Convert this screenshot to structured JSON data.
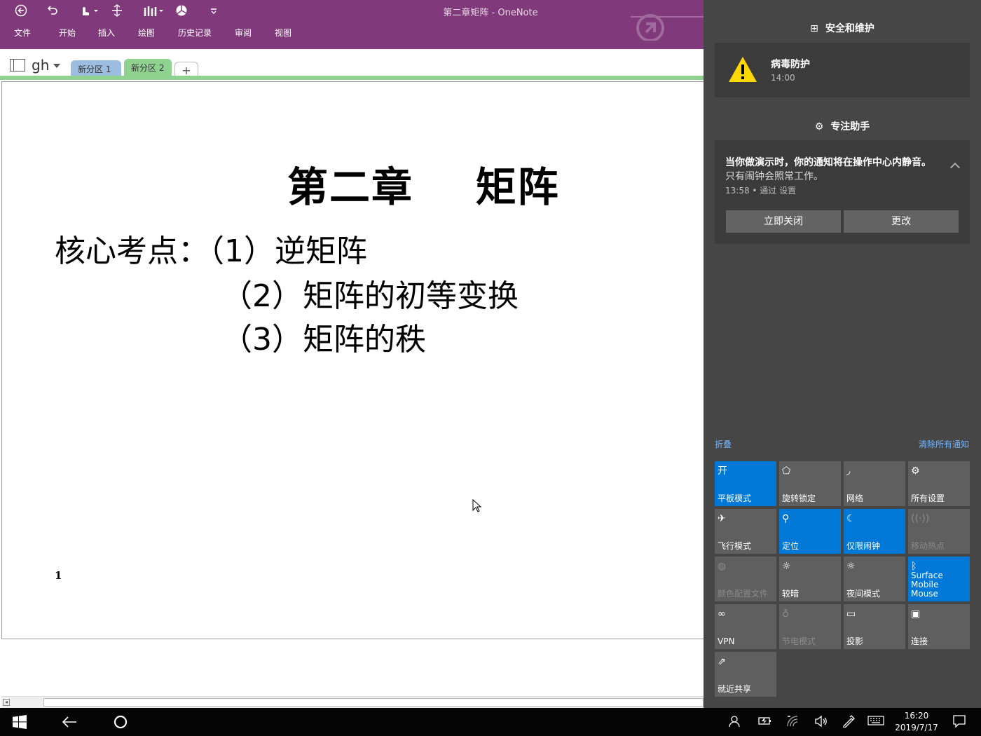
{
  "window": {
    "title": "第二章矩阵 - OneNote",
    "quick_access": [
      "back-icon",
      "undo-icon",
      "touch-mode-icon",
      "insert-space-icon",
      "pens-icon",
      "pie-icon",
      "customize-icon"
    ],
    "menu": [
      "文件",
      "开始",
      "插入",
      "绘图",
      "历史记录",
      "审阅",
      "视图"
    ]
  },
  "notebook": {
    "name": "gh",
    "sections": [
      "新分区 1",
      "新分区 2"
    ],
    "add_section": "+"
  },
  "page": {
    "title": "第二章    矩阵",
    "key_points_label": "核心考点：",
    "key_points": [
      "（1）逆矩阵",
      "（2）矩阵的初等变换",
      "（3）矩阵的秩"
    ],
    "page_number": "1"
  },
  "action_center": {
    "group1": {
      "title": "安全和维护",
      "icon": "security-icon"
    },
    "notif1": {
      "title": "病毒防护",
      "time": "14:00",
      "icon": "warning-icon"
    },
    "group2": {
      "title": "专注助手",
      "icon": "gear-icon"
    },
    "notif2": {
      "title": "当你做演示时，你的通知将在操作中心内静音。",
      "body": "只有闹钟会照常工作。",
      "meta": "13:58 • 通过 设置",
      "button1": "立即关闭",
      "button2": "更改"
    },
    "collapse": "折叠",
    "clear_all": "清除所有通知",
    "tiles": [
      {
        "label": "平板模式",
        "icon_text": "开",
        "state": "on"
      },
      {
        "label": "旋转锁定",
        "icon_text": "⬠",
        "state": "off"
      },
      {
        "label": "网络",
        "icon_text": "◞",
        "state": "off"
      },
      {
        "label": "所有设置",
        "icon_text": "⚙",
        "state": "off"
      },
      {
        "label": "飞行模式",
        "icon_text": "✈",
        "state": "off"
      },
      {
        "label": "定位",
        "icon_text": "⚲",
        "state": "on"
      },
      {
        "label": "仅限闹钟",
        "icon_text": "☾",
        "state": "on"
      },
      {
        "label": "移动热点",
        "icon_text": "((·))",
        "state": "disabled"
      },
      {
        "label": "颜色配置文件",
        "icon_text": "◍",
        "state": "disabled"
      },
      {
        "label": "较暗",
        "icon_text": "☼",
        "state": "off"
      },
      {
        "label": "夜间模式",
        "icon_text": "☼",
        "state": "off"
      },
      {
        "label": "Surface Mobile Mouse",
        "icon_text": "ᛒ",
        "state": "on"
      },
      {
        "label": "VPN",
        "icon_text": "∞",
        "state": "off"
      },
      {
        "label": "节电模式",
        "icon_text": "♁",
        "state": "disabled"
      },
      {
        "label": "投影",
        "icon_text": "▭",
        "state": "off"
      },
      {
        "label": "连接",
        "icon_text": "▣",
        "state": "off"
      },
      {
        "label": "就近共享",
        "icon_text": "⇗",
        "state": "off"
      }
    ]
  },
  "taskbar": {
    "time": "16:20",
    "date": "2019/7/17",
    "icons": [
      "start-icon",
      "back-icon",
      "cortana-icon",
      "people-icon",
      "battery-icon",
      "wifi-icon",
      "volume-icon",
      "pen-icon",
      "keyboard-icon",
      "notification-icon"
    ]
  },
  "colors": {
    "ribbon": "#80397b",
    "section1": "#9dbde0",
    "section2": "#8fd18f",
    "accent": "#0078d7",
    "action_center_bg": "#464646"
  }
}
